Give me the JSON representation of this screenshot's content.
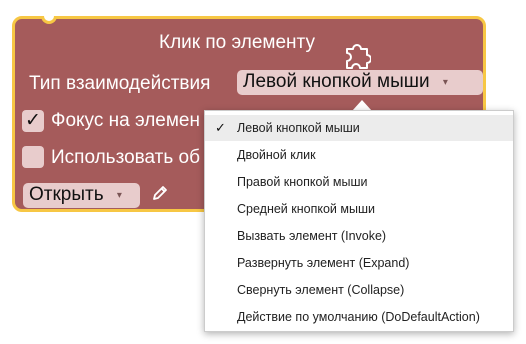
{
  "block": {
    "title": "Клик по элементу",
    "interaction_label": "Тип взаимодействия",
    "interaction_value": "Левой кнопкой мыши",
    "focus_checkbox_checked": true,
    "focus_checkmark": "✓",
    "focus_label": "Фокус на элемен",
    "use_checkbox_checked": false,
    "use_label": "Использовать об",
    "open_dropdown_value": "Открыть",
    "caret": "▾",
    "colors": {
      "block": "#a55b5b",
      "border": "#f7c744",
      "field": "#e8cccc"
    },
    "icons": [
      "puzzle-icon",
      "pencil-icon"
    ]
  },
  "menu": {
    "selected_mark": "✓",
    "items": [
      "Левой кнопкой мыши",
      "Двойной клик",
      "Правой кнопкой мыши",
      "Средней кнопкой мыши",
      "Вызвать элемент (Invoke)",
      "Развернуть элемент (Expand)",
      "Свернуть элемент (Collapse)",
      "Действие по умолчанию (DoDefaultAction)"
    ]
  }
}
